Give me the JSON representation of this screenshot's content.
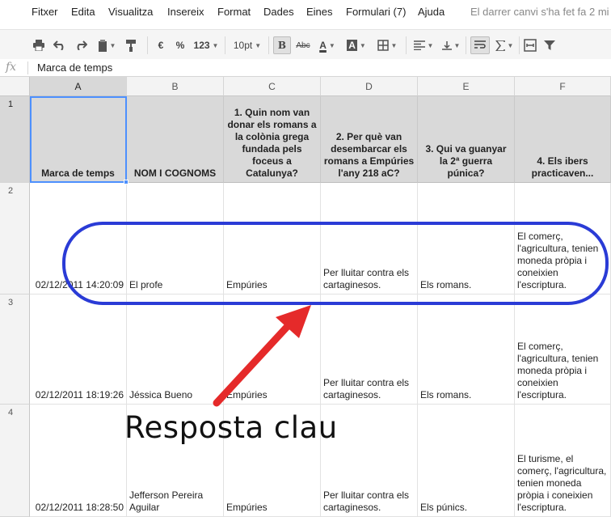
{
  "menu": {
    "items": [
      "Fitxer",
      "Edita",
      "Visualitza",
      "Insereix",
      "Format",
      "Dades",
      "Eines",
      "Formulari (7)",
      "Ajuda"
    ],
    "status": "El darrer canvi s'ha fet fa 2 mi"
  },
  "toolbar": {
    "currency": "€",
    "percent": "%",
    "number_format": "123",
    "font_size": "10pt",
    "bold": "B",
    "strikethrough": "Abc",
    "text_color": "A",
    "fill_color": "A",
    "icons": [
      "print-icon",
      "undo-icon",
      "redo-icon",
      "paint-format-icon",
      "borders-icon",
      "align-icon",
      "wrap-icon",
      "sum-icon",
      "merge-icon",
      "filter-icon"
    ]
  },
  "formula_bar": {
    "fx": "fx",
    "value": "Marca de temps"
  },
  "columns": [
    "A",
    "B",
    "C",
    "D",
    "E",
    "F"
  ],
  "rows": [
    {
      "num": "1",
      "cells": [
        "Marca de temps",
        "NOM I COGNOMS",
        "1. Quin nom van donar els romans a la colònia grega fundada pels foceus a Catalunya?",
        "2. Per què van desembarcar els romans a Empúries l'any 218 aC?",
        "3. Qui va guanyar la 2ª guerra púnica?",
        "4. Els ibers practicaven..."
      ]
    },
    {
      "num": "2",
      "cells": [
        "02/12/2011 14:20:09",
        "El profe",
        "Empúries",
        "Per lluitar contra els cartaginesos.",
        "Els romans.",
        "El comerç, l'agricultura, tenien moneda pròpia i coneixien l'escriptura."
      ]
    },
    {
      "num": "3",
      "cells": [
        "02/12/2011 18:19:26",
        "Jéssica Bueno",
        "Empúries",
        "Per lluitar contra els cartaginesos.",
        "Els romans.",
        "El comerç, l'agricultura, tenien moneda pròpia i coneixien l'escriptura."
      ]
    },
    {
      "num": "4",
      "cells": [
        "02/12/2011 18:28:50",
        "Jefferson Pereira Aguilar",
        "Empúries",
        "Per lluitar contra els cartaginesos.",
        "Els púnics.",
        "El turisme, el comerç, l'agricultura, tenien moneda pròpia i coneixien l'escriptura."
      ]
    }
  ],
  "annotation": {
    "text": "Resposta clau",
    "color": "#e52a2a",
    "highlight_color": "#2a3bd6"
  }
}
